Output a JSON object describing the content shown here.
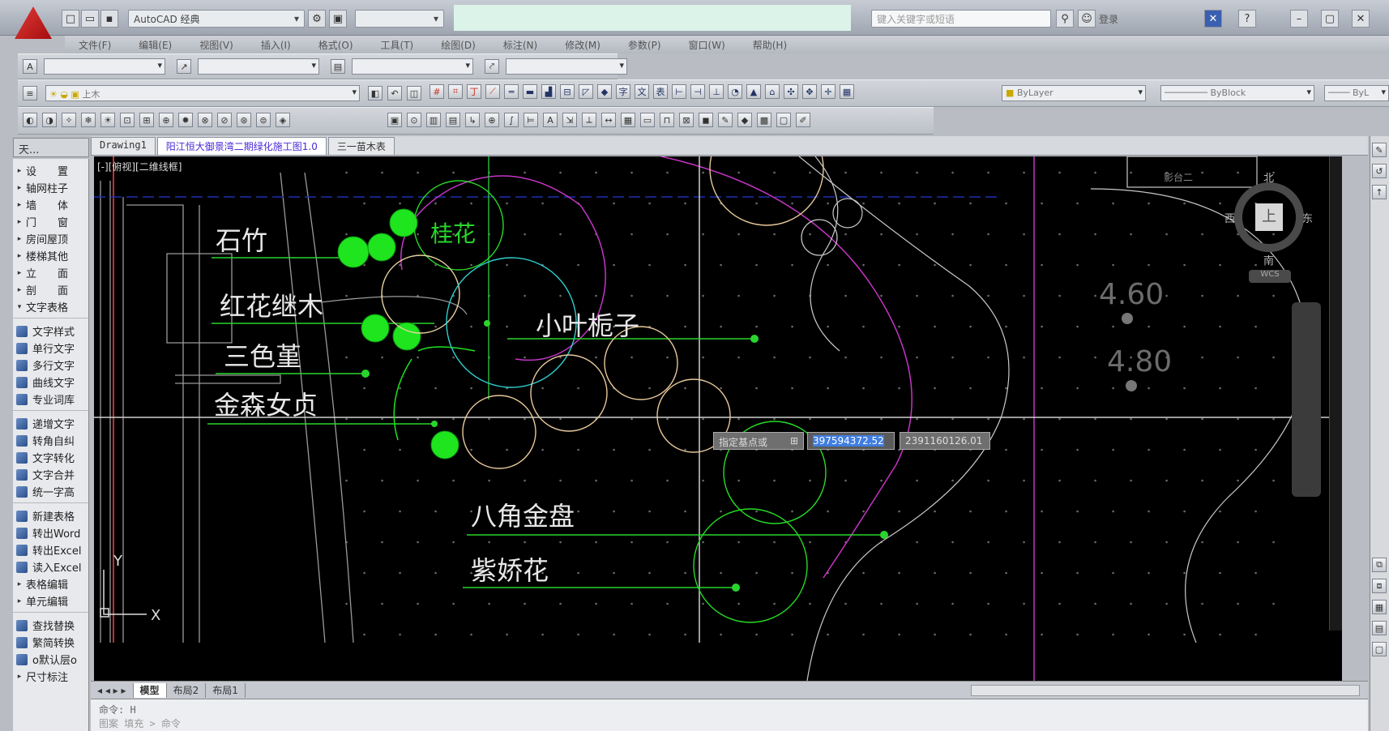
{
  "app": {
    "workspace": "AutoCAD 经典",
    "search_placeholder": "键入关键字或短语",
    "login_label": "登录"
  },
  "menu": [
    "文件(F)",
    "编辑(E)",
    "视图(V)",
    "插入(I)",
    "格式(O)",
    "工具(T)",
    "绘图(D)",
    "标注(N)",
    "修改(M)",
    "参数(P)",
    "窗口(W)",
    "帮助(H)"
  ],
  "layer_toolbar": {
    "layer_value": "上木",
    "color_value": "ByLayer",
    "linetype_value": "ByBlock",
    "lineweight_value": "ByL"
  },
  "palette_title": "天...",
  "sidebar": [
    {
      "label": "设　　置",
      "type": "group"
    },
    {
      "label": "轴网柱子",
      "type": "group"
    },
    {
      "label": "墙　　体",
      "type": "group"
    },
    {
      "label": "门　　窗",
      "type": "group"
    },
    {
      "label": "房间屋顶",
      "type": "group"
    },
    {
      "label": "楼梯其他",
      "type": "group"
    },
    {
      "label": "立　　面",
      "type": "group"
    },
    {
      "label": "剖　　面",
      "type": "group"
    },
    {
      "label": "文字表格",
      "type": "open"
    },
    {
      "label": "文字样式",
      "type": "item"
    },
    {
      "label": "单行文字",
      "type": "item"
    },
    {
      "label": "多行文字",
      "type": "item"
    },
    {
      "label": "曲线文字",
      "type": "item"
    },
    {
      "label": "专业词库",
      "type": "item"
    },
    {
      "label": "递增文字",
      "type": "item"
    },
    {
      "label": "转角自纠",
      "type": "item"
    },
    {
      "label": "文字转化",
      "type": "item"
    },
    {
      "label": "文字合并",
      "type": "item"
    },
    {
      "label": "统一字高",
      "type": "item"
    },
    {
      "label": "新建表格",
      "type": "item"
    },
    {
      "label": "转出Word",
      "type": "item"
    },
    {
      "label": "转出Excel",
      "type": "item"
    },
    {
      "label": "读入Excel",
      "type": "item"
    },
    {
      "label": "表格编辑",
      "type": "group"
    },
    {
      "label": "单元编辑",
      "type": "group"
    },
    {
      "label": "查找替换",
      "type": "item"
    },
    {
      "label": "繁简转换",
      "type": "item"
    },
    {
      "label": "o默认层o",
      "type": "item"
    },
    {
      "label": "尺寸标注",
      "type": "group"
    }
  ],
  "tabs": [
    "Drawing1",
    "阳江恒大御景湾二期绿化施工图1.0",
    "三一苗木表"
  ],
  "viewport_label": "[-][俯视][二维线框]",
  "plant_labels": [
    "石竹",
    "红花继木",
    "三色堇",
    "金森女贞",
    "桂花",
    "小叶栀子",
    "八角金盘",
    "紫娇花"
  ],
  "elevations": [
    "4.60",
    "4.80"
  ],
  "canvas_note": "影台二",
  "navcube": {
    "north": "北",
    "south": "南",
    "east": "东",
    "west": "西",
    "top": "上",
    "wcs": "WCS"
  },
  "ucs": {
    "x": "X",
    "y": "Y"
  },
  "dynamic_input": {
    "prompt": "指定基点或",
    "x_value": "397594372.52",
    "y_value": "2391160126.01"
  },
  "layout_tabs": [
    "模型",
    "布局2",
    "布局1"
  ],
  "command_line": [
    "命令: H",
    "图案 填充 > 命令"
  ]
}
